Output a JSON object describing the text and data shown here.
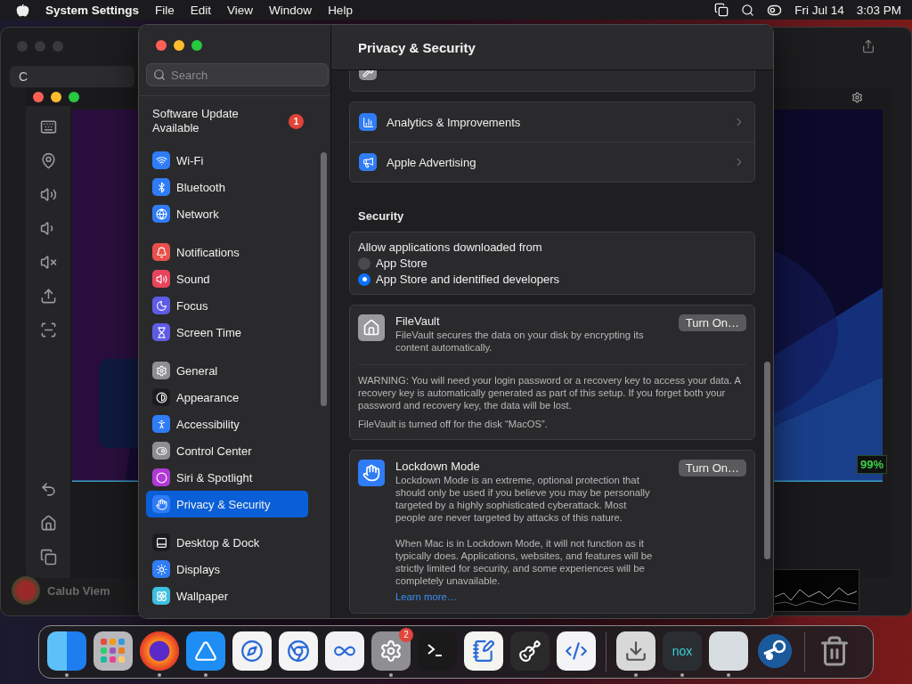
{
  "menu_bar": {
    "app": "System Settings",
    "menus": [
      "File",
      "Edit",
      "View",
      "Window",
      "Help"
    ],
    "date": "Fri Jul 14",
    "time": "3:03 PM"
  },
  "background_window": {
    "search_text": "C",
    "battery_reading": "99%",
    "user_name": "Calub Viem"
  },
  "settings": {
    "title": "Privacy & Security",
    "search": {
      "placeholder": "Search"
    },
    "update": {
      "label": "Software Update Available",
      "badge": "1"
    },
    "sidebar_groups": [
      [
        {
          "label": "Wi-Fi",
          "color": "#2f7cf6",
          "selected": false
        },
        {
          "label": "Bluetooth",
          "color": "#2f7cf6",
          "selected": false
        },
        {
          "label": "Network",
          "color": "#2f7cf6",
          "selected": false
        }
      ],
      [
        {
          "label": "Notifications",
          "color": "#e8514b",
          "selected": false
        },
        {
          "label": "Sound",
          "color": "#e8455d",
          "selected": false
        },
        {
          "label": "Focus",
          "color": "#5e5ce6",
          "selected": false
        },
        {
          "label": "Screen Time",
          "color": "#5e5ce6",
          "selected": false
        }
      ],
      [
        {
          "label": "General",
          "color": "#8e8e93",
          "selected": false
        },
        {
          "label": "Appearance",
          "color": "#1c1c1e",
          "selected": false
        },
        {
          "label": "Accessibility",
          "color": "#2f7cf6",
          "selected": false
        },
        {
          "label": "Control Center",
          "color": "#8e8e93",
          "selected": false
        },
        {
          "label": "Siri & Spotlight",
          "color": "#b13ad6",
          "selected": false
        },
        {
          "label": "Privacy & Security",
          "color": "#2f7cf6",
          "selected": true
        }
      ],
      [
        {
          "label": "Desktop & Dock",
          "color": "#1c1c1e",
          "selected": false
        },
        {
          "label": "Displays",
          "color": "#2f7cf6",
          "selected": false
        },
        {
          "label": "Wallpaper",
          "color": "#3ebfe0",
          "selected": false
        }
      ]
    ],
    "privacy_cards": [
      [
        "Analytics & Improvements",
        "Apple Advertising"
      ]
    ],
    "security": {
      "heading": "Security",
      "allow_label": "Allow applications downloaded from",
      "options": [
        {
          "label": "App Store",
          "selected": false
        },
        {
          "label": "App Store and identified developers",
          "selected": true
        }
      ],
      "filevault": {
        "title": "FileVault",
        "description": "FileVault secures the data on your disk by encrypting its content automatically.",
        "button": "Turn On…",
        "warning": "WARNING: You will need your login password or a recovery key to access your data. A recovery key is automatically generated as part of this setup. If you forget both your password and recovery key, the data will be lost.",
        "status": "FileVault is turned off for the disk “MacOS”."
      },
      "lockdown": {
        "title": "Lockdown Mode",
        "description": "Lockdown Mode is an extreme, optional protection that should only be used if you believe you may be personally targeted by a highly sophisticated cyberattack. Most people are never targeted by attacks of this nature.",
        "description_2": "When Mac is in Lockdown Mode, it will not function as it typically does. Applications, websites, and features will be strictly limited for security, and some experiences will be completely unavailable.",
        "link": "Learn more…",
        "button": "Turn On…"
      }
    }
  },
  "dock": {
    "items": [
      {
        "running": true
      },
      {
        "running": false
      },
      {
        "running": true
      },
      {
        "running": true
      },
      {
        "running": false
      },
      {
        "running": false
      },
      {
        "running": false
      },
      {
        "running": true,
        "badge": "2"
      },
      {
        "running": false
      },
      {
        "running": false
      },
      {
        "running": false
      },
      {
        "running": false
      },
      {
        "running": true
      },
      {
        "running": true,
        "label": "nox"
      },
      {
        "running": true
      },
      {
        "running": false
      },
      {
        "running": false
      }
    ]
  }
}
